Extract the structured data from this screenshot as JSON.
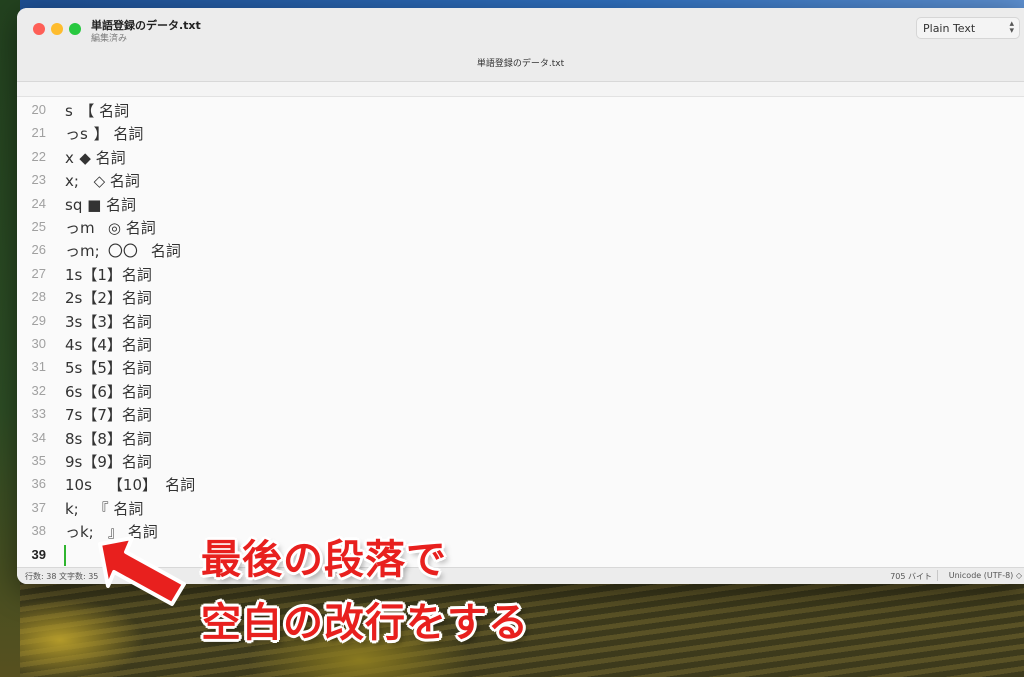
{
  "window": {
    "title": "単語登録のデータ.txt",
    "subtitle": "編集済み",
    "tab_title": "単語登録のデータ.txt",
    "format_select": {
      "value": "Plain Text",
      "icon": "chevron-updown-icon"
    }
  },
  "editor": {
    "lines": [
      {
        "num": "20",
        "text": "s\t【 名詞"
      },
      {
        "num": "21",
        "text": "っs\t】 名詞"
      },
      {
        "num": "22",
        "text": "x\t◆ 名詞"
      },
      {
        "num": "23",
        "text": "x;\t◇ 名詞"
      },
      {
        "num": "24",
        "text": "sq ■ 名詞"
      },
      {
        "num": "25",
        "text": "っm\t◎ 名詞"
      },
      {
        "num": "26",
        "text": "っm;\t〇〇\t名詞"
      },
      {
        "num": "27",
        "text": "1s【1】名詞"
      },
      {
        "num": "28",
        "text": "2s【2】名詞"
      },
      {
        "num": "29",
        "text": "3s【3】名詞"
      },
      {
        "num": "30",
        "text": "4s【4】名詞"
      },
      {
        "num": "31",
        "text": "5s【5】名詞"
      },
      {
        "num": "32",
        "text": "6s【6】名詞"
      },
      {
        "num": "33",
        "text": "7s【7】名詞"
      },
      {
        "num": "34",
        "text": "8s【8】名詞"
      },
      {
        "num": "35",
        "text": "9s【9】名詞"
      },
      {
        "num": "36",
        "text": "10s\t【10】\t名詞"
      },
      {
        "num": "37",
        "text": "k;\t『 名詞"
      },
      {
        "num": "38",
        "text": "っk;\t』 名詞"
      },
      {
        "num": "39",
        "text": ""
      }
    ],
    "current_line": "39",
    "caret_color": "#2fb52f"
  },
  "status": {
    "left": "行数: 38  文字数: 35",
    "bytes": "705 バイト",
    "encoding": "Unicode (UTF-8) ◇"
  },
  "annotation": {
    "line1": "最後の段落で",
    "line2": "空白の改行をする",
    "color": "#e8201e"
  }
}
